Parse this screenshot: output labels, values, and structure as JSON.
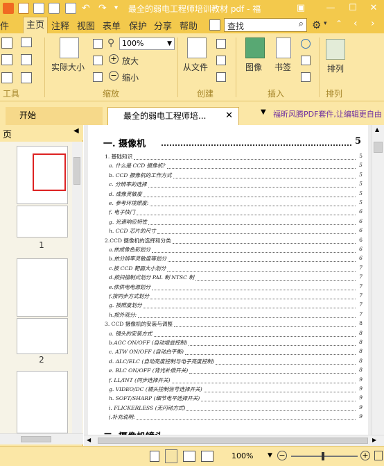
{
  "titlebar": {
    "title": "最全的弱电工程师培训教材 pdf - 福"
  },
  "menu": {
    "items": [
      "件",
      "主页",
      "注释",
      "视图",
      "表单",
      "保护",
      "分享",
      "帮助"
    ],
    "search_placeholder": "查找"
  },
  "ribbon": {
    "zoom_value": "100%",
    "actual_size": "实际大小",
    "zoom_in": "放大",
    "zoom_out": "缩小",
    "from_file": "从文件",
    "image": "图像",
    "bookmark": "书签",
    "arrange": "排列",
    "groups": {
      "tools": "工具",
      "zoom": "缩放",
      "create": "创建",
      "insert": "插入",
      "arrange": "排列"
    }
  },
  "tabs": {
    "start": "开始",
    "doc": "最全的弱电工程师培...",
    "ad": "福昕风腾PDF套件,让编辑更自由"
  },
  "left_panel": {
    "header": "页",
    "thumbs": [
      {
        "num": "1"
      },
      {
        "num": "2"
      }
    ]
  },
  "document": {
    "heading": "一. 摄像机",
    "heading_page": "5",
    "toc": [
      {
        "text": "1. 基础知识",
        "page": "5",
        "sub": false
      },
      {
        "text": "a. 什么是 CCD 摄像机?",
        "page": "5",
        "sub": true
      },
      {
        "text": "b. CCD 摄像机的工作方式",
        "page": "5",
        "sub": true
      },
      {
        "text": "c. 分辨率的选择",
        "page": "5",
        "sub": true
      },
      {
        "text": "d. 成像灵敏度",
        "page": "5",
        "sub": true
      },
      {
        "text": "e. 参考环境照度:",
        "page": "5",
        "sub": true
      },
      {
        "text": "f. 电子快门",
        "page": "6",
        "sub": true
      },
      {
        "text": "g. 光谱响应特性",
        "page": "6",
        "sub": true
      },
      {
        "text": "h. CCD 芯片的尺寸",
        "page": "6",
        "sub": true
      },
      {
        "text": "2.CCD 摄像机的选择和分类",
        "page": "6",
        "sub": false
      },
      {
        "text": "a.依成像色彩划分",
        "page": "6",
        "sub": true
      },
      {
        "text": "b.依分辨率灵敏度等划分",
        "page": "6",
        "sub": true
      },
      {
        "text": "c.按 CCD 靶面大小划分",
        "page": "7",
        "sub": true
      },
      {
        "text": "d.按扫描制式划分 PAL 制 NTSC 制",
        "page": "7",
        "sub": true
      },
      {
        "text": "e.依供电电源划分",
        "page": "7",
        "sub": true
      },
      {
        "text": "f.按同步方式划分",
        "page": "7",
        "sub": true
      },
      {
        "text": "g. 按照度划分",
        "page": "7",
        "sub": true
      },
      {
        "text": "h.按外观分:",
        "page": "7",
        "sub": true
      },
      {
        "text": "3. CCD 摄像机的安装与调整",
        "page": "8",
        "sub": false
      },
      {
        "text": "a. 镜头的安装方式",
        "page": "8",
        "sub": true
      },
      {
        "text": "b.AGC ON/OFF (自动增益控制)",
        "page": "8",
        "sub": true
      },
      {
        "text": "c. ATW ON/OFF (自动白平衡)",
        "page": "8",
        "sub": true
      },
      {
        "text": "d. ALC/ELC (自动亮度控制与电子亮度控制)",
        "page": "8",
        "sub": true
      },
      {
        "text": "e. BLC ON/OFF (背光补偿开关)",
        "page": "8",
        "sub": true
      },
      {
        "text": "f. LL/INT (同步选择开关)",
        "page": "9",
        "sub": true
      },
      {
        "text": "g. VIDEO/DC (镜头控制信号选择开关)",
        "page": "9",
        "sub": true
      },
      {
        "text": "h. SOFT/SHARP (细节电平选择开关)",
        "page": "9",
        "sub": true
      },
      {
        "text": "i. FLICKERLESS (无闪动方式)",
        "page": "9",
        "sub": true
      },
      {
        "text": "j.补充说明:",
        "page": "9",
        "sub": true
      }
    ],
    "next_heading": "二. 摄像机镜头"
  },
  "statusbar": {
    "zoom": "100%"
  },
  "colors": {
    "title_bar": "#f3c94c",
    "ribbon": "#fbe7a6",
    "accent_ad": "#7030a0"
  }
}
